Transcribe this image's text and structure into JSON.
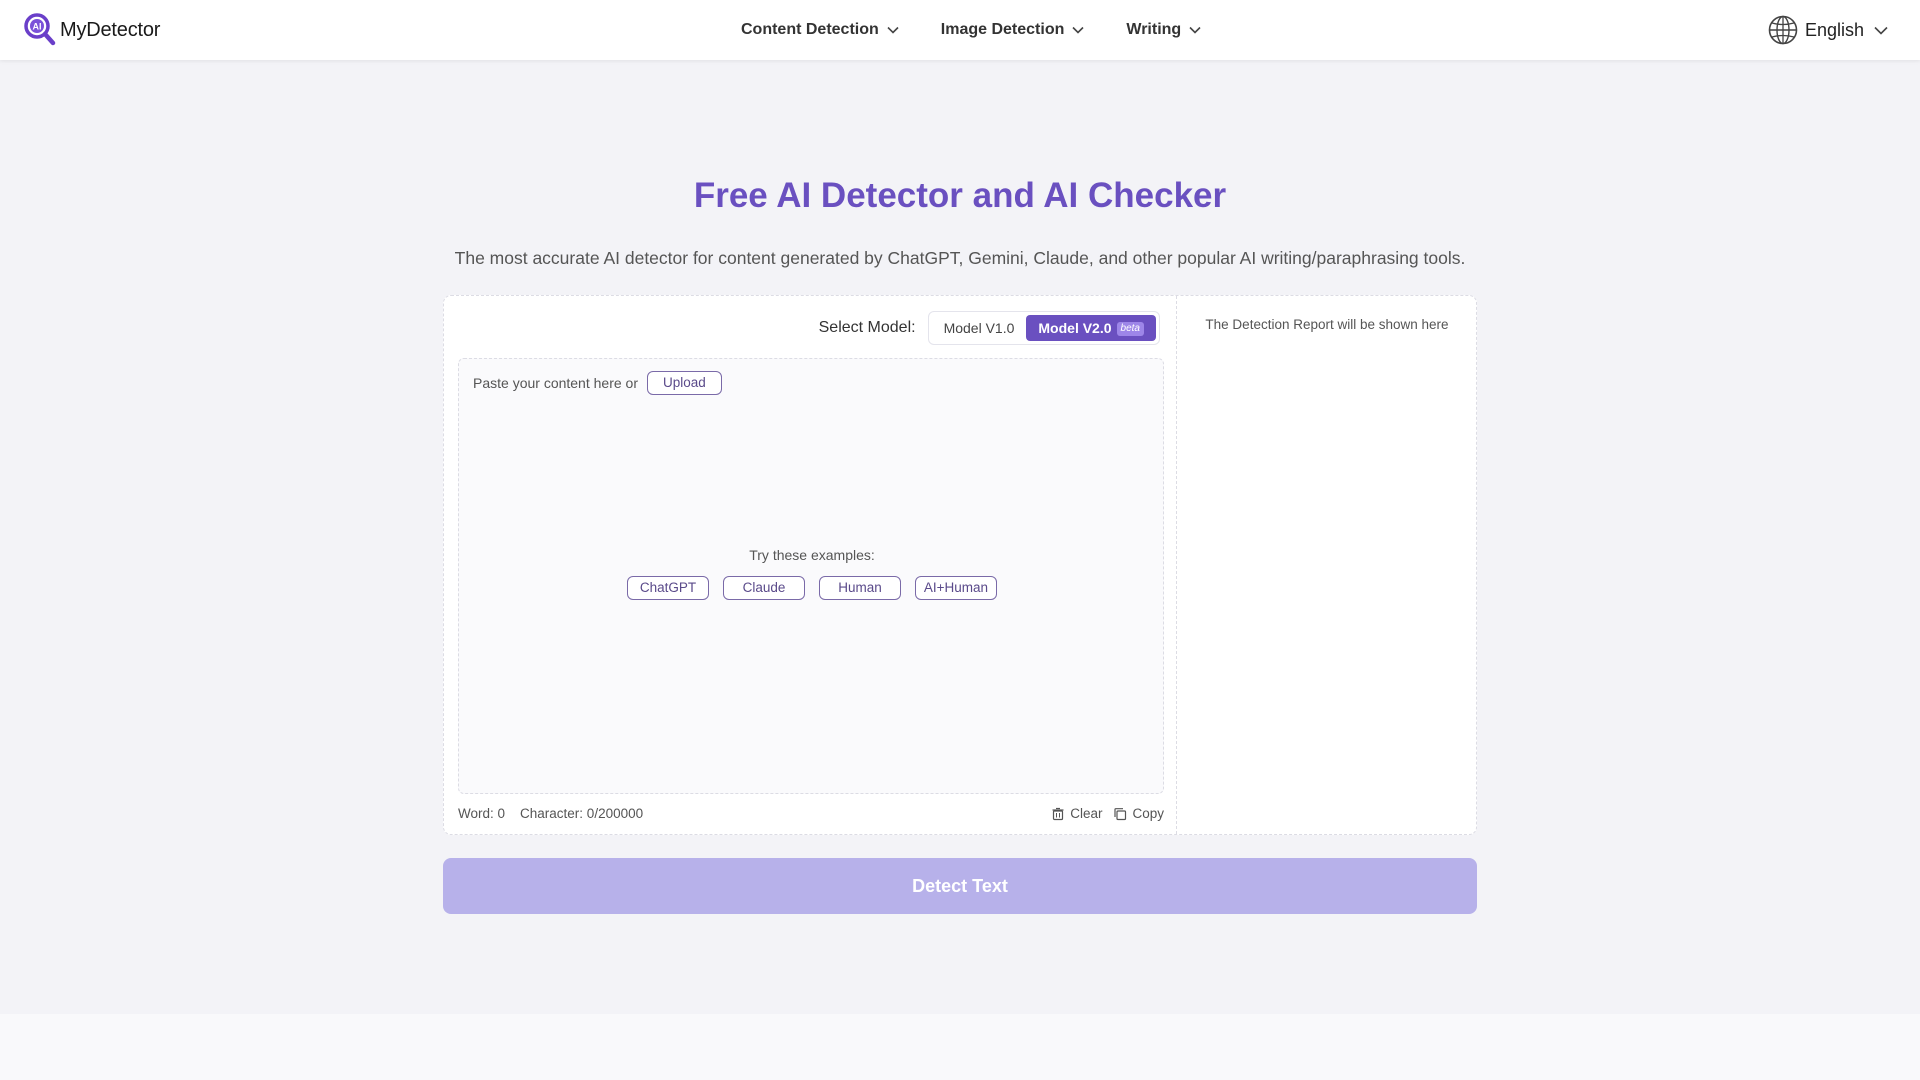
{
  "header": {
    "logo_text": "MyDetector",
    "nav": [
      {
        "label": "Content Detection"
      },
      {
        "label": "Image Detection"
      },
      {
        "label": "Writing"
      }
    ],
    "language": "English"
  },
  "hero": {
    "title": "Free AI Detector and AI Checker",
    "subtitle": "The most accurate AI detector for content generated by ChatGPT, Gemini, Claude, and other popular AI writing/paraphrasing tools."
  },
  "model": {
    "label": "Select Model:",
    "options": [
      {
        "label": "Model V1.0"
      },
      {
        "label": "Model V2.0",
        "badge": "beta"
      }
    ],
    "selected": "Model V2.0"
  },
  "editor": {
    "paste_label": "Paste your content here or",
    "upload_label": "Upload",
    "examples_label": "Try these examples:",
    "examples": [
      "ChatGPT",
      "Claude",
      "Human",
      "AI+Human"
    ],
    "word_count": "Word: 0",
    "char_count": "Character: 0/200000",
    "clear_label": "Clear",
    "copy_label": "Copy"
  },
  "report": {
    "placeholder": "The Detection Report will be shown here"
  },
  "detect_button": "Detect Text",
  "colors": {
    "accent": "#6a50c0",
    "button_disabled": "#b7b1ea",
    "background": "#f3f3f7"
  }
}
